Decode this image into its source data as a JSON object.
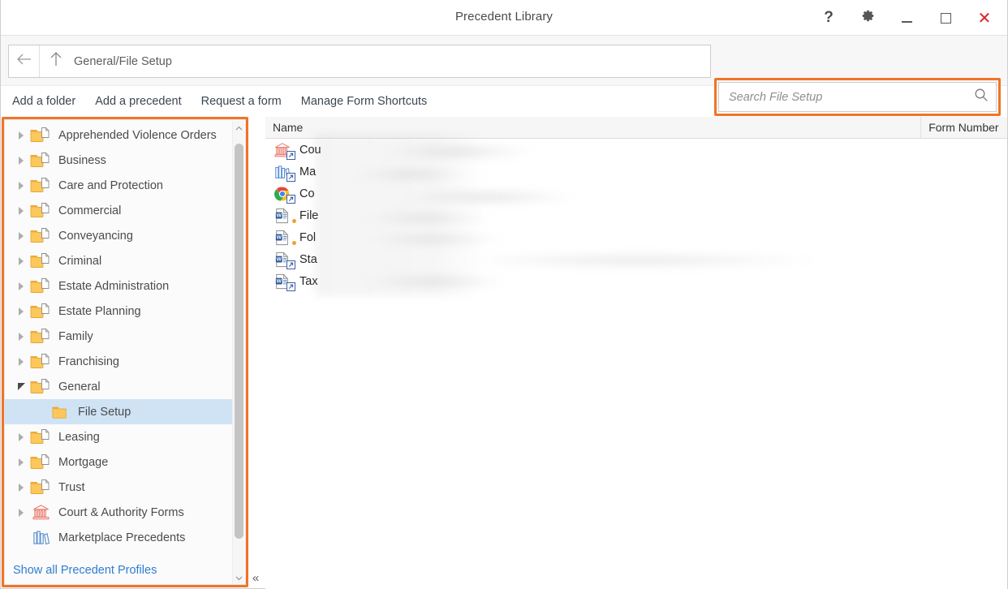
{
  "window": {
    "title": "Precedent Library",
    "controls": [
      {
        "name": "help-button",
        "glyph": "?"
      },
      {
        "name": "settings-gear-button",
        "glyph": "gear"
      },
      {
        "name": "minimize-button",
        "glyph": "minimize"
      },
      {
        "name": "maximize-button",
        "glyph": "maximize"
      },
      {
        "name": "close-button",
        "glyph": "✕"
      }
    ]
  },
  "navbar": {
    "back_icon": "arrow-left-icon",
    "up_icon": "arrow-up-icon",
    "path": "General/File Setup"
  },
  "search": {
    "placeholder": "Search File Setup",
    "value": "",
    "icon": "search-icon",
    "highlight_color": "#f07427"
  },
  "commandbar": {
    "items": [
      {
        "label": "Add a folder",
        "name": "add-a-folder-link"
      },
      {
        "label": "Add a precedent",
        "name": "add-a-precedent-link"
      },
      {
        "label": "Request a form",
        "name": "request-a-form-link"
      },
      {
        "label": "Manage Form Shortcuts",
        "name": "manage-form-shortcuts-link"
      }
    ]
  },
  "sidebar": {
    "highlight_color": "#f07427",
    "selected_bg": "#cfe3f5",
    "show_all_link": "Show all Precedent Profiles",
    "collapse_glyph": "«",
    "scroll_up_glyph": "⌃",
    "scroll_down_glyph": "⌄",
    "items": [
      {
        "label": "Apprehended Violence Orders",
        "icon": "folder-document-icon",
        "state": "collapsed",
        "level": 0
      },
      {
        "label": "Business",
        "icon": "folder-document-icon",
        "state": "collapsed",
        "level": 0
      },
      {
        "label": "Care and Protection",
        "icon": "folder-document-icon",
        "state": "collapsed",
        "level": 0
      },
      {
        "label": "Commercial",
        "icon": "folder-document-icon",
        "state": "collapsed",
        "level": 0
      },
      {
        "label": "Conveyancing",
        "icon": "folder-document-icon",
        "state": "collapsed",
        "level": 0
      },
      {
        "label": "Criminal",
        "icon": "folder-document-icon",
        "state": "collapsed",
        "level": 0
      },
      {
        "label": "Estate Administration",
        "icon": "folder-document-icon",
        "state": "collapsed",
        "level": 0
      },
      {
        "label": "Estate Planning",
        "icon": "folder-document-icon",
        "state": "collapsed",
        "level": 0
      },
      {
        "label": "Family",
        "icon": "folder-document-icon",
        "state": "collapsed",
        "level": 0
      },
      {
        "label": "Franchising",
        "icon": "folder-document-icon",
        "state": "collapsed",
        "level": 0
      },
      {
        "label": "General",
        "icon": "folder-document-icon",
        "state": "expanded",
        "level": 0
      },
      {
        "label": "File Setup",
        "icon": "folder-icon",
        "state": "selected",
        "level": 1
      },
      {
        "label": "Leasing",
        "icon": "folder-document-icon",
        "state": "collapsed",
        "level": 0
      },
      {
        "label": "Mortgage",
        "icon": "folder-document-icon",
        "state": "collapsed",
        "level": 0
      },
      {
        "label": "Trust",
        "icon": "folder-document-icon",
        "state": "collapsed",
        "level": 0
      },
      {
        "label": "Court & Authority Forms",
        "icon": "courthouse-icon",
        "state": "collapsed",
        "level": 0
      },
      {
        "label": "Marketplace Precedents",
        "icon": "books-icon",
        "state": "leaf",
        "level": 0
      }
    ]
  },
  "filelist": {
    "columns": [
      {
        "label": "Name",
        "name": "column-header-name"
      },
      {
        "label": "Form Number",
        "name": "column-header-form-number"
      }
    ],
    "redacted": true,
    "rows": [
      {
        "name_visible": "Cou",
        "icon": "courthouse-shortcut-icon",
        "form_number": ""
      },
      {
        "name_visible": "Ma",
        "icon": "books-shortcut-icon",
        "form_number": ""
      },
      {
        "name_visible": "Co",
        "icon": "chrome-shortcut-icon",
        "form_number": ""
      },
      {
        "name_visible": "File",
        "icon": "word-document-dot-icon",
        "form_number": ""
      },
      {
        "name_visible": "Fol",
        "icon": "word-document-dot-icon",
        "form_number": ""
      },
      {
        "name_visible": "Sta",
        "icon": "word-document-shortcut-icon",
        "form_number": ""
      },
      {
        "name_visible": "Tax",
        "icon": "word-document-shortcut-icon",
        "form_number": ""
      }
    ]
  }
}
